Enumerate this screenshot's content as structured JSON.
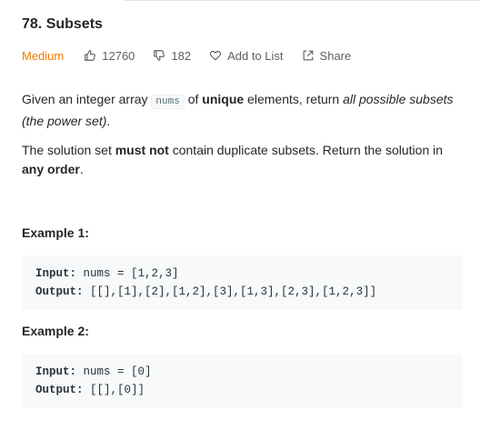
{
  "problem": {
    "title": "78. Subsets",
    "difficulty": "Medium",
    "likes": "12760",
    "dislikes": "182",
    "add_to_list": "Add to List",
    "share": "Share"
  },
  "description": {
    "p1_a": "Given an integer array ",
    "p1_code": "nums",
    "p1_b": " of ",
    "p1_bold": "unique",
    "p1_c": " elements, return ",
    "p1_italic": "all possible subsets (the power set)",
    "p1_d": ".",
    "p2_a": "The solution set ",
    "p2_bold1": "must not",
    "p2_b": " contain duplicate subsets. Return the solution in ",
    "p2_bold2": "any order",
    "p2_c": "."
  },
  "examples": [
    {
      "title": "Example 1:",
      "input_label": "Input:",
      "input_value": " nums = [1,2,3]",
      "output_label": "Output:",
      "output_value": " [[],[1],[2],[1,2],[3],[1,3],[2,3],[1,2,3]]"
    },
    {
      "title": "Example 2:",
      "input_label": "Input:",
      "input_value": " nums = [0]",
      "output_label": "Output:",
      "output_value": " [[],[0]]"
    }
  ],
  "colors": {
    "difficulty_medium": "#ef7d00",
    "meta_text": "#5c6166",
    "code_bg": "#f7f9fa"
  },
  "icons": [
    "thumbs-up-icon",
    "thumbs-down-icon",
    "heart-icon",
    "share-icon"
  ]
}
